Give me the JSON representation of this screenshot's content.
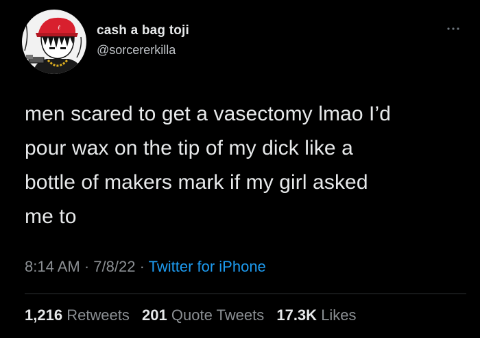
{
  "author": {
    "display_name": "cash a bag toji",
    "handle": "@sorcererkilla",
    "avatar_icon": "user-avatar-icon"
  },
  "more_icon": "more-dots-icon",
  "tweet": {
    "text": "men scared to get a vasectomy lmao I’d\npour wax on the tip of my dick like a\nbottle of makers mark if my girl asked\nme to",
    "time": "8:14 AM",
    "separator": " · ",
    "date": "7/8/22",
    "source": "Twitter for iPhone"
  },
  "stats": {
    "retweets_count": "1,216",
    "retweets_label": "Retweets",
    "quotes_count": "201",
    "quotes_label": "Quote Tweets",
    "likes_count": "17.3K",
    "likes_label": "Likes"
  },
  "colors": {
    "background": "#000000",
    "text": "#e7e9ea",
    "secondary": "#8b8f93",
    "link": "#1d9bf0",
    "divider": "#2f3336"
  }
}
